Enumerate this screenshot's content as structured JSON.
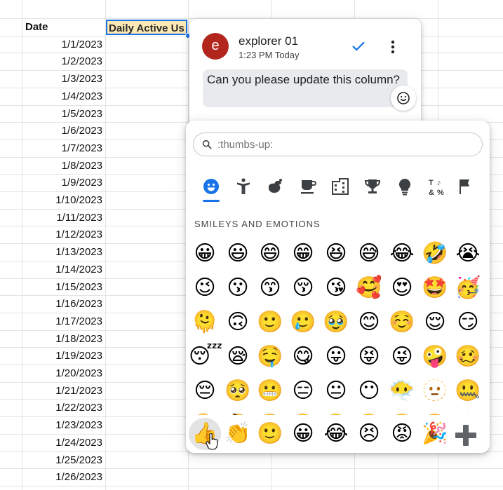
{
  "sheet": {
    "header_date": "Date",
    "header_dau": "Daily Active Us",
    "dates": [
      "1/1/2023",
      "1/2/2023",
      "1/3/2023",
      "1/4/2023",
      "1/5/2023",
      "1/6/2023",
      "1/7/2023",
      "1/8/2023",
      "1/9/2023",
      "1/10/2023",
      "1/11/2023",
      "1/12/2023",
      "1/13/2023",
      "1/14/2023",
      "1/15/2023",
      "1/16/2023",
      "1/17/2023",
      "1/18/2023",
      "1/19/2023",
      "1/20/2023",
      "1/21/2023",
      "1/22/2023",
      "1/23/2023",
      "1/24/2023",
      "1/25/2023",
      "1/26/2023"
    ]
  },
  "comment": {
    "avatar_letter": "e",
    "author": "explorer 01",
    "time": "1:23 PM Today",
    "text": "Can you please update this column?",
    "avatar_color": "#b3261e"
  },
  "picker": {
    "search_placeholder": ":thumbs-up:",
    "categories": [
      "smileys-emotion",
      "people-body",
      "animals-nature",
      "food-drink",
      "travel-places",
      "activities",
      "objects",
      "symbols",
      "flags"
    ],
    "section_title": "SMILEYS AND EMOTIONS",
    "emoji_rows": [
      [
        "😀",
        "😃",
        "😄",
        "😁",
        "😆",
        "😅",
        "😂",
        "🤣",
        "😭"
      ],
      [
        "😉",
        "😗",
        "😙",
        "😚",
        "😘",
        "🥰",
        "😍",
        "🤩",
        "🥳"
      ],
      [
        "🫠",
        "🙃",
        "🙂",
        "🥲",
        "🥹",
        "😊",
        "☺️",
        "😌",
        "😏"
      ],
      [
        "😴",
        "😪",
        "🤤",
        "😋",
        "😛",
        "😝",
        "😜",
        "🤪",
        "🥴"
      ],
      [
        "😔",
        "🥺",
        "😬",
        "😑",
        "😐",
        "😶",
        "😶‍🌫️",
        "🫥",
        "🤐"
      ],
      [
        "🫡",
        "🤔",
        "🤫",
        "🫢",
        "🤭",
        "🥱",
        "🤗",
        "🫣",
        "😱"
      ]
    ],
    "recent": [
      "👍",
      "👏",
      "🙂",
      "😀",
      "😂",
      "😣",
      "😡",
      "🎉"
    ],
    "accent": "#1a73e8"
  }
}
